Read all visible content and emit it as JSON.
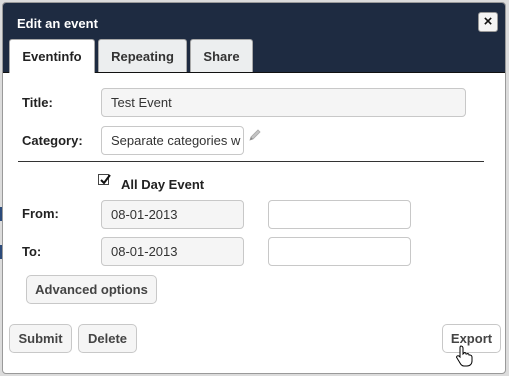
{
  "dialog": {
    "title": "Edit an event",
    "close_label": "×"
  },
  "tabs": [
    {
      "label": "Eventinfo",
      "active": true
    },
    {
      "label": "Repeating",
      "active": false
    },
    {
      "label": "Share",
      "active": false
    }
  ],
  "form": {
    "title_label": "Title:",
    "title_value": "Test Event",
    "category_label": "Category:",
    "category_value": "Separate categories w",
    "all_day_label": "All Day Event",
    "all_day_checked": true,
    "from_label": "From:",
    "from_date": "08-01-2013",
    "from_time": "",
    "to_label": "To:",
    "to_date": "08-01-2013",
    "to_time": ""
  },
  "buttons": {
    "advanced": "Advanced options",
    "submit": "Submit",
    "delete": "Delete",
    "export": "Export"
  },
  "icons": {
    "close": "close-icon",
    "edit": "pencil-icon",
    "check": "checkmark-icon",
    "cursor": "hand-cursor-icon"
  }
}
